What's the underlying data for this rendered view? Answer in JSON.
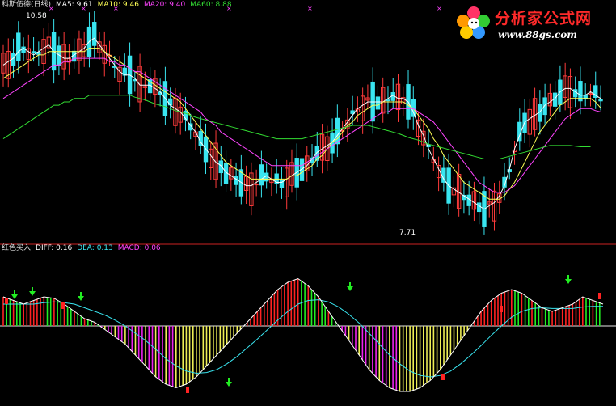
{
  "legend_top": {
    "name": "科斯伍德(日线)",
    "ma5": "MA5: 9.61",
    "ma10": "MA10: 9.46",
    "ma20": "MA20: 9.40",
    "ma60": "MA60: 8.88"
  },
  "legend_bottom": {
    "name": "红色买入",
    "diff": "DIFF: 0.16",
    "dea": "DEA: 0.13",
    "macd": "MACD: 0.06"
  },
  "logo": {
    "title": "分析家公式网",
    "url": "www.88gs.com"
  },
  "colors": {
    "up": "#ff3b3b",
    "down": "#39e5f0",
    "ma5": "#ffffff",
    "ma10": "#ffff55",
    "ma20": "#ff44ff",
    "ma60": "#33dd33",
    "macd_red": "#ff2222",
    "macd_green": "#22ee22",
    "macd_magenta": "#ee22ee",
    "macd_yellow": "#eeee55"
  },
  "chart_data": [
    {
      "type": "candlestick",
      "series": [
        {
          "name": "MA5",
          "values": [
            10.1,
            10.15,
            10.2,
            10.3,
            10.35,
            10.3,
            10.25,
            10.3,
            10.35,
            10.4,
            10.3,
            10.25,
            10.2,
            10.2,
            10.25,
            10.3,
            10.35,
            10.45,
            10.5,
            10.4,
            10.3,
            10.2,
            10.1,
            10.0,
            9.95,
            9.95,
            9.9,
            9.8,
            9.8,
            9.8,
            9.75,
            9.7,
            9.6,
            9.5,
            9.45,
            9.4,
            9.3,
            9.2,
            9.1,
            8.95,
            8.85,
            8.75,
            8.65,
            8.6,
            8.5,
            8.45,
            8.4,
            8.35,
            8.3,
            8.3,
            8.35,
            8.4,
            8.45,
            8.4,
            8.35,
            8.35,
            8.4,
            8.45,
            8.5,
            8.55,
            8.6,
            8.7,
            8.8,
            8.85,
            8.9,
            8.95,
            9.05,
            9.15,
            9.25,
            9.35,
            9.45,
            9.5,
            9.55,
            9.55,
            9.55,
            9.55,
            9.6,
            9.65,
            9.6,
            9.6,
            9.55,
            9.4,
            9.2,
            9.05,
            8.85,
            8.7,
            8.55,
            8.4,
            8.3,
            8.25,
            8.2,
            8.15,
            8.1,
            8.05,
            8.0,
            7.95,
            8.0,
            8.05,
            8.15,
            8.3,
            8.55,
            8.85,
            9.05,
            9.25,
            9.3,
            9.35,
            9.4,
            9.5,
            9.55,
            9.6,
            9.7,
            9.75,
            9.75,
            9.7,
            9.65,
            9.65,
            9.7,
            9.65,
            9.6
          ]
        },
        {
          "name": "MA10",
          "values": [
            9.9,
            9.95,
            10.0,
            10.05,
            10.1,
            10.15,
            10.2,
            10.25,
            10.25,
            10.3,
            10.3,
            10.3,
            10.3,
            10.3,
            10.3,
            10.3,
            10.3,
            10.35,
            10.35,
            10.35,
            10.3,
            10.25,
            10.2,
            10.15,
            10.1,
            10.05,
            10.0,
            9.95,
            9.9,
            9.85,
            9.8,
            9.75,
            9.7,
            9.65,
            9.6,
            9.55,
            9.45,
            9.35,
            9.25,
            9.15,
            9.05,
            8.95,
            8.85,
            8.75,
            8.65,
            8.6,
            8.55,
            8.5,
            8.45,
            8.4,
            8.4,
            8.4,
            8.4,
            8.4,
            8.4,
            8.4,
            8.4,
            8.45,
            8.45,
            8.5,
            8.55,
            8.6,
            8.7,
            8.75,
            8.85,
            8.95,
            9.0,
            9.1,
            9.2,
            9.25,
            9.35,
            9.4,
            9.45,
            9.5,
            9.5,
            9.55,
            9.55,
            9.55,
            9.55,
            9.55,
            9.5,
            9.45,
            9.35,
            9.25,
            9.15,
            9.0,
            8.9,
            8.75,
            8.65,
            8.55,
            8.45,
            8.35,
            8.3,
            8.25,
            8.2,
            8.15,
            8.1,
            8.1,
            8.1,
            8.15,
            8.25,
            8.35,
            8.5,
            8.65,
            8.8,
            8.95,
            9.1,
            9.2,
            9.3,
            9.4,
            9.5,
            9.55,
            9.6,
            9.6,
            9.6,
            9.6,
            9.6,
            9.55,
            9.46
          ]
        },
        {
          "name": "MA20",
          "values": [
            9.6,
            9.65,
            9.7,
            9.75,
            9.8,
            9.85,
            9.9,
            9.95,
            10.0,
            10.05,
            10.1,
            10.1,
            10.15,
            10.15,
            10.2,
            10.2,
            10.2,
            10.2,
            10.2,
            10.2,
            10.2,
            10.15,
            10.15,
            10.1,
            10.1,
            10.05,
            10.0,
            10.0,
            9.95,
            9.9,
            9.85,
            9.8,
            9.75,
            9.7,
            9.65,
            9.6,
            9.55,
            9.5,
            9.45,
            9.4,
            9.3,
            9.25,
            9.2,
            9.1,
            9.05,
            9.0,
            8.95,
            8.9,
            8.85,
            8.8,
            8.75,
            8.7,
            8.65,
            8.6,
            8.6,
            8.6,
            8.6,
            8.6,
            8.6,
            8.6,
            8.65,
            8.7,
            8.75,
            8.8,
            8.85,
            8.9,
            8.95,
            9.0,
            9.05,
            9.1,
            9.15,
            9.2,
            9.25,
            9.3,
            9.35,
            9.4,
            9.4,
            9.45,
            9.45,
            9.45,
            9.45,
            9.45,
            9.4,
            9.35,
            9.3,
            9.25,
            9.15,
            9.05,
            8.95,
            8.85,
            8.75,
            8.65,
            8.55,
            8.45,
            8.35,
            8.3,
            8.25,
            8.2,
            8.2,
            8.2,
            8.25,
            8.3,
            8.4,
            8.5,
            8.6,
            8.7,
            8.8,
            8.9,
            9.0,
            9.1,
            9.2,
            9.3,
            9.35,
            9.4,
            9.45,
            9.45,
            9.45,
            9.42,
            9.4
          ]
        },
        {
          "name": "MA60",
          "values": [
            9.0,
            9.05,
            9.1,
            9.15,
            9.2,
            9.25,
            9.3,
            9.35,
            9.4,
            9.45,
            9.5,
            9.5,
            9.55,
            9.55,
            9.6,
            9.6,
            9.6,
            9.65,
            9.65,
            9.65,
            9.65,
            9.65,
            9.65,
            9.65,
            9.65,
            9.65,
            9.62,
            9.6,
            9.58,
            9.55,
            9.52,
            9.5,
            9.48,
            9.45,
            9.42,
            9.4,
            9.38,
            9.35,
            9.32,
            9.3,
            9.28,
            9.26,
            9.24,
            9.22,
            9.2,
            9.18,
            9.16,
            9.14,
            9.12,
            9.1,
            9.08,
            9.06,
            9.04,
            9.02,
            9.0,
            9.0,
            9.0,
            9.0,
            9.0,
            9.0,
            9.02,
            9.04,
            9.06,
            9.08,
            9.1,
            9.12,
            9.14,
            9.16,
            9.18,
            9.2,
            9.2,
            9.2,
            9.2,
            9.18,
            9.16,
            9.14,
            9.12,
            9.1,
            9.08,
            9.05,
            9.02,
            9.0,
            8.98,
            8.95,
            8.92,
            8.9,
            8.88,
            8.86,
            8.84,
            8.82,
            8.8,
            8.78,
            8.76,
            8.74,
            8.72,
            8.7,
            8.7,
            8.7,
            8.7,
            8.72,
            8.74,
            8.76,
            8.78,
            8.8,
            8.82,
            8.84,
            8.86,
            8.88,
            8.9,
            8.9,
            8.9,
            8.9,
            8.9,
            8.89,
            8.88,
            8.88,
            8.88
          ]
        }
      ],
      "annotations": [
        "10.58",
        "7.71"
      ],
      "ylim": [
        7.5,
        10.9
      ]
    },
    {
      "type": "bar",
      "series": [
        {
          "name": "DIFF",
          "values": [
            0.4,
            0.35,
            0.3,
            0.35,
            0.4,
            0.38,
            0.3,
            0.2,
            0.1,
            0.05,
            -0.05,
            -0.15,
            -0.25,
            -0.4,
            -0.55,
            -0.7,
            -0.8,
            -0.85,
            -0.8,
            -0.7,
            -0.55,
            -0.4,
            -0.25,
            -0.1,
            0.05,
            0.2,
            0.35,
            0.5,
            0.6,
            0.65,
            0.55,
            0.4,
            0.2,
            0.0,
            -0.2,
            -0.4,
            -0.6,
            -0.75,
            -0.85,
            -0.9,
            -0.9,
            -0.85,
            -0.75,
            -0.6,
            -0.4,
            -0.2,
            0.0,
            0.2,
            0.35,
            0.45,
            0.5,
            0.45,
            0.35,
            0.25,
            0.2,
            0.25,
            0.3,
            0.4,
            0.35,
            0.3
          ]
        },
        {
          "name": "DEA",
          "values": [
            0.3,
            0.3,
            0.3,
            0.3,
            0.32,
            0.33,
            0.32,
            0.3,
            0.25,
            0.2,
            0.15,
            0.08,
            0.0,
            -0.1,
            -0.2,
            -0.32,
            -0.45,
            -0.55,
            -0.62,
            -0.65,
            -0.64,
            -0.6,
            -0.52,
            -0.42,
            -0.3,
            -0.18,
            -0.05,
            0.08,
            0.2,
            0.3,
            0.35,
            0.36,
            0.33,
            0.26,
            0.16,
            0.04,
            -0.1,
            -0.25,
            -0.4,
            -0.52,
            -0.62,
            -0.68,
            -0.7,
            -0.68,
            -0.62,
            -0.52,
            -0.4,
            -0.27,
            -0.13,
            0.0,
            0.12,
            0.2,
            0.24,
            0.25,
            0.24,
            0.24,
            0.24,
            0.26,
            0.27,
            0.27
          ]
        }
      ],
      "ylim": [
        -1.0,
        1.0
      ]
    }
  ]
}
